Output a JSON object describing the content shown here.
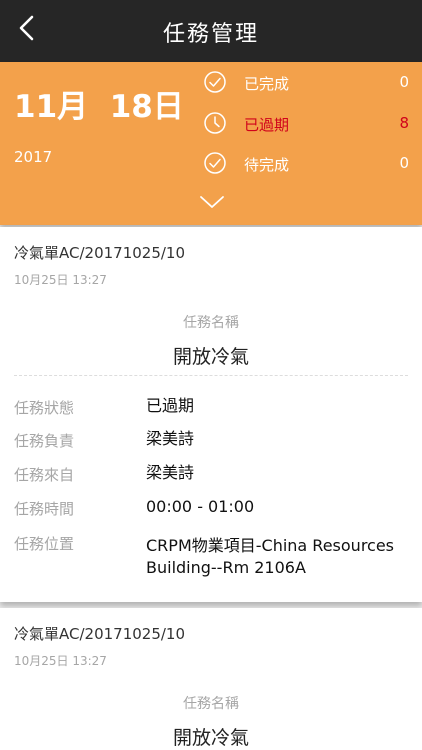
{
  "header": {
    "title": "任務管理",
    "back_icon": "chevron-left-icon"
  },
  "summary": {
    "date": "11月  18日",
    "year": "2017",
    "stats": [
      {
        "label": "已完成",
        "count": "0",
        "icon": "check-circle-icon"
      },
      {
        "label": "已過期",
        "count": "8",
        "icon": "clock-icon",
        "color": "#d0021b"
      },
      {
        "label": "待完成",
        "count": "0",
        "icon": "check-circle-icon"
      }
    ],
    "expand_icon": "chevron-down-icon"
  },
  "tasks": [
    {
      "code": "冷氣單AC/20171025/10",
      "time": "10月25日 13:27",
      "name_label": "任務名稱",
      "name": "開放冷氣",
      "fields": [
        {
          "label": "任務狀態",
          "value": "已過期"
        },
        {
          "label": "任務負責",
          "value": "梁美詩"
        },
        {
          "label": "任務來自",
          "value": "梁美詩"
        },
        {
          "label": "任務時間",
          "value": "00:00 - 01:00"
        },
        {
          "label": "任務位置",
          "value": "CRPM物業項目-China Resources Building--Rm 2106A"
        }
      ]
    },
    {
      "code": "冷氣單AC/20171025/10",
      "time": "10月25日 13:27",
      "name_label": "任務名稱",
      "name": "開放冷氣"
    }
  ],
  "colors": {
    "navbar": "#262626",
    "accent": "#f3a14b",
    "overdue": "#d0021b"
  }
}
